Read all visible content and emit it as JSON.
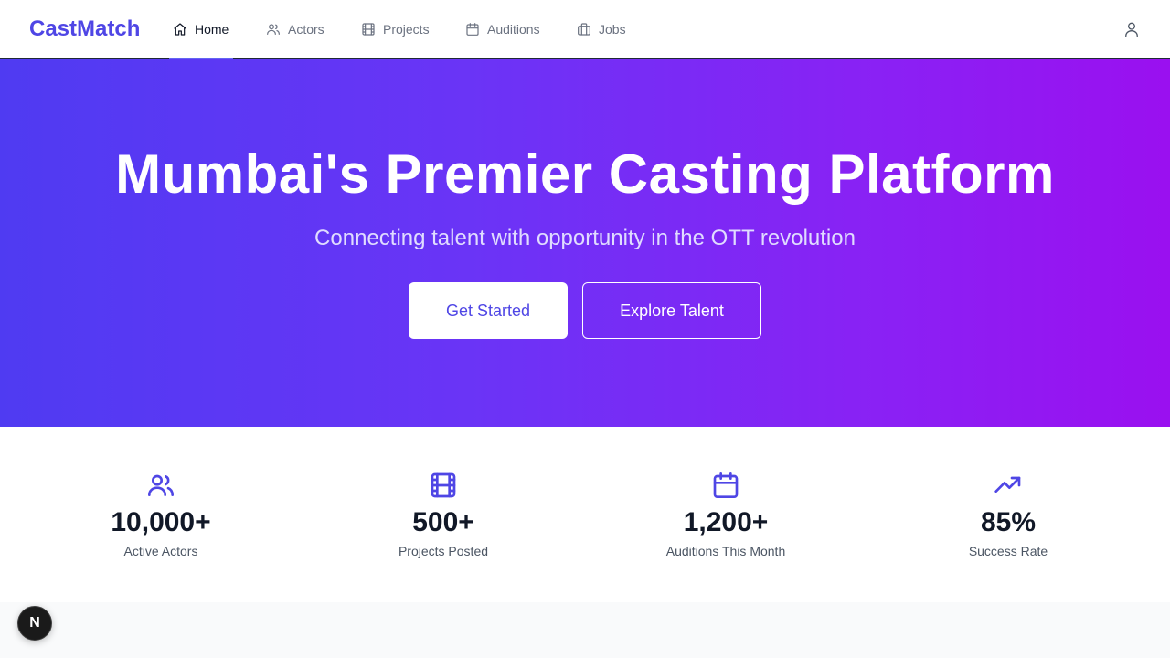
{
  "brand": {
    "name": "CastMatch"
  },
  "nav": {
    "items": [
      {
        "label": "Home",
        "icon": "home-icon",
        "active": true
      },
      {
        "label": "Actors",
        "icon": "users-icon",
        "active": false
      },
      {
        "label": "Projects",
        "icon": "film-icon",
        "active": false
      },
      {
        "label": "Auditions",
        "icon": "calendar-icon",
        "active": false
      },
      {
        "label": "Jobs",
        "icon": "briefcase-icon",
        "active": false
      }
    ],
    "user_icon": "user-icon"
  },
  "hero": {
    "title": "Mumbai's Premier Casting Platform",
    "subtitle": "Connecting talent with opportunity in the OTT revolution",
    "primary_cta": "Get Started",
    "secondary_cta": "Explore Talent"
  },
  "stats": [
    {
      "value": "10,000+",
      "label": "Active Actors",
      "icon": "users-icon"
    },
    {
      "value": "500+",
      "label": "Projects Posted",
      "icon": "film-icon"
    },
    {
      "value": "1,200+",
      "label": "Auditions This Month",
      "icon": "calendar-icon"
    },
    {
      "value": "85%",
      "label": "Success Rate",
      "icon": "trending-up-icon"
    }
  ],
  "dev_badge": {
    "letter": "N",
    "icon": "nextjs-icon"
  },
  "colors": {
    "accent": "#4f46e5",
    "hero_gradient_start": "#4f3bf2",
    "hero_gradient_end": "#9a10f0",
    "text_dark": "#111827",
    "text_muted": "#6b7280"
  }
}
